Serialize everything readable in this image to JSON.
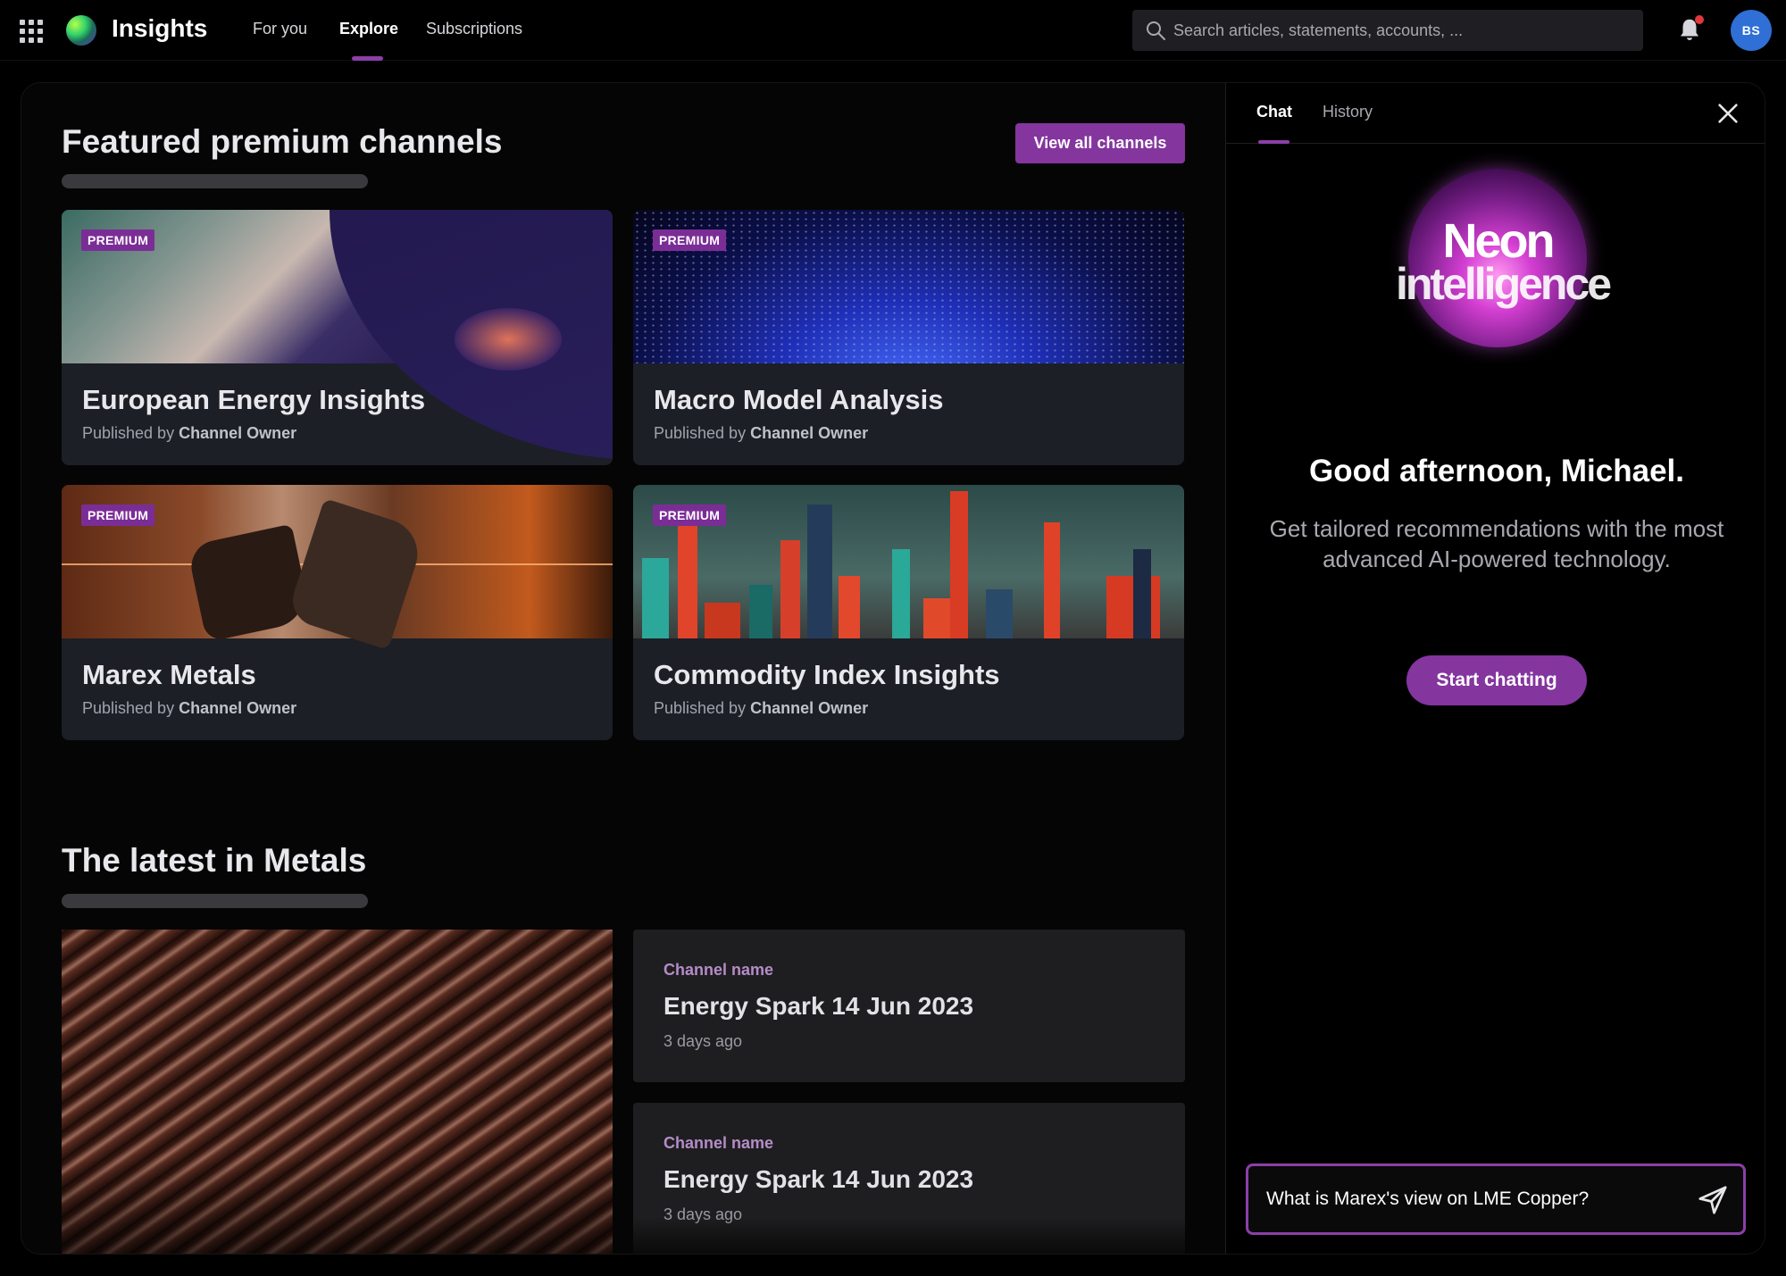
{
  "header": {
    "app_title": "Insights",
    "nav": [
      {
        "label": "For you",
        "active": false
      },
      {
        "label": "Explore",
        "active": true
      },
      {
        "label": "Subscriptions",
        "active": false
      }
    ],
    "search_placeholder": "Search articles, statements, accounts, ...",
    "avatar_initials": "BS",
    "accent_color": "#84359e",
    "notification_dot_color": "#e0383e"
  },
  "featured": {
    "title": "Featured premium channels",
    "view_all_label": "View all channels",
    "cards": [
      {
        "badge": "PREMIUM",
        "title": "European Energy Insights",
        "published_by_label": "Published by",
        "owner": "Channel Owner"
      },
      {
        "badge": "PREMIUM",
        "title": "Macro Model Analysis",
        "published_by_label": "Published by",
        "owner": "Channel Owner"
      },
      {
        "badge": "PREMIUM",
        "title": "Marex Metals",
        "published_by_label": "Published by",
        "owner": "Channel Owner"
      },
      {
        "badge": "PREMIUM",
        "title": "Commodity Index Insights",
        "published_by_label": "Published by",
        "owner": "Channel Owner"
      }
    ]
  },
  "latest": {
    "title": "The latest in Metals",
    "articles": [
      {
        "channel": "Channel name",
        "title": "Energy Spark 14 Jun 2023",
        "time": "3 days ago"
      },
      {
        "channel": "Channel name",
        "title": "Energy Spark 14 Jun 2023",
        "time": "3 days ago"
      }
    ]
  },
  "chat": {
    "tabs": [
      {
        "label": "Chat",
        "active": true
      },
      {
        "label": "History",
        "active": false
      }
    ],
    "logo_line1": "Neon",
    "logo_line2": "intelligence",
    "greeting": "Good afternoon, Michael.",
    "tagline": "Get tailored recommendations with the most advanced AI-powered technology.",
    "start_label": "Start chatting",
    "input_value": "What is Marex's view on LME Copper?"
  }
}
